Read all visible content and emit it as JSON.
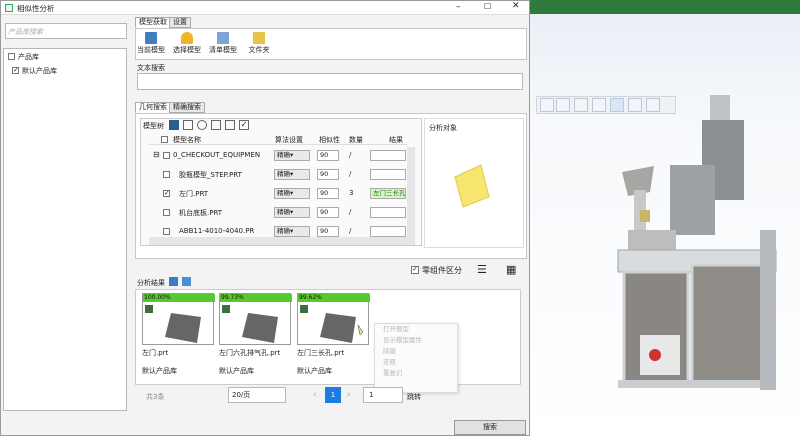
{
  "window": {
    "title": "相似性分析"
  },
  "left": {
    "search_placeholder": "产品库搜索",
    "tree": [
      {
        "label": "产品库",
        "checked": false
      },
      {
        "label": "默认产品库",
        "checked": true
      }
    ]
  },
  "top_tabs": [
    "模型获取",
    "设置"
  ],
  "toolbar": [
    {
      "label": "当前模型",
      "icon": "monitor-icon"
    },
    {
      "label": "选择模型",
      "icon": "lock-icon"
    },
    {
      "label": "清单模型",
      "icon": "list-icon"
    },
    {
      "label": "文件夹",
      "icon": "folder-icon"
    }
  ],
  "text_search": {
    "label": "文本搜索",
    "value": ""
  },
  "geo_tabs": [
    "几何搜索",
    "精确搜索"
  ],
  "model_tree": {
    "label": "模型树",
    "columns": [
      "模型名称",
      "算法设置",
      "相似性",
      "数量",
      "结果"
    ],
    "rows": [
      {
        "name": "0_CHECKOUT_EQUIPMEN",
        "algo": "精确▾",
        "sim": "90",
        "qty": "/",
        "result": "",
        "checked": false,
        "expand": "⊟"
      },
      {
        "name": "胶瓶模型_STEP.PRT",
        "algo": "精确▾",
        "sim": "90",
        "qty": "/",
        "result": "",
        "checked": false,
        "expand": ""
      },
      {
        "name": "左门.PRT",
        "algo": "精确▾",
        "sim": "90",
        "qty": "3",
        "result": "左门三长孔",
        "checked": true,
        "expand": ""
      },
      {
        "name": "机台底板.PRT",
        "algo": "精确▾",
        "sim": "90",
        "qty": "/",
        "result": "",
        "checked": false,
        "expand": ""
      },
      {
        "name": "ABB11-4010-4040.PR",
        "algo": "精确▾",
        "sim": "90",
        "qty": "/",
        "result": "",
        "checked": false,
        "expand": ""
      }
    ]
  },
  "analysis_object": {
    "label": "分析对象"
  },
  "part_distinguish": {
    "label": "零组件区分",
    "checked": true
  },
  "results": {
    "label": "分析结果",
    "cards": [
      {
        "pct": "100.00%",
        "fill": 1.0,
        "name": "左门.prt",
        "lib": "默认产品库"
      },
      {
        "pct": "99.73%",
        "fill": 0.9973,
        "name": "左门六孔排气孔.prt",
        "lib": "默认产品库"
      },
      {
        "pct": "99.62%",
        "fill": 0.9962,
        "name": "左门三长孔.prt",
        "lib": "默认产品库"
      }
    ]
  },
  "context_menu": [
    "打开模型",
    "显示模型属性",
    "除屋",
    "还原",
    "重复们"
  ],
  "pagination": {
    "total": "共3条",
    "per_page": "20/页",
    "current": "1",
    "goto_value": "1",
    "goto_label": "跳转"
  },
  "search_button": "搜索",
  "colors": {
    "green": "#57c92e",
    "accent": "#1e7be0",
    "part": "#f3e36a"
  }
}
